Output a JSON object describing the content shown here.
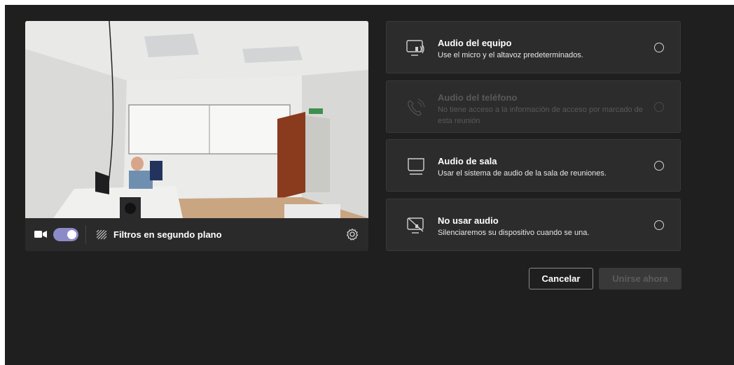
{
  "video_controls": {
    "camera_on": true,
    "filters_label": "Filtros en segundo plano"
  },
  "audio_options": [
    {
      "title": "Audio del equipo",
      "description": "Use el micro y el altavoz predeterminados.",
      "icon": "computer-audio-icon",
      "enabled": true,
      "selected": false
    },
    {
      "title": "Audio del teléfono",
      "description": "No tiene acceso a la información de acceso por marcado de esta reunión",
      "icon": "phone-audio-icon",
      "enabled": false,
      "selected": false
    },
    {
      "title": "Audio de sala",
      "description": "Usar el sistema de audio de la sala de reuniones.",
      "icon": "room-audio-icon",
      "enabled": true,
      "selected": false
    },
    {
      "title": "No usar audio",
      "description": "Silenciaremos su dispositivo cuando se una.",
      "icon": "no-audio-icon",
      "enabled": true,
      "selected": false
    }
  ],
  "actions": {
    "cancel_label": "Cancelar",
    "join_label": "Unirse ahora"
  },
  "colors": {
    "background": "#201f1f",
    "card": "#2d2c2c",
    "toggle_accent": "#8b8cc7"
  }
}
